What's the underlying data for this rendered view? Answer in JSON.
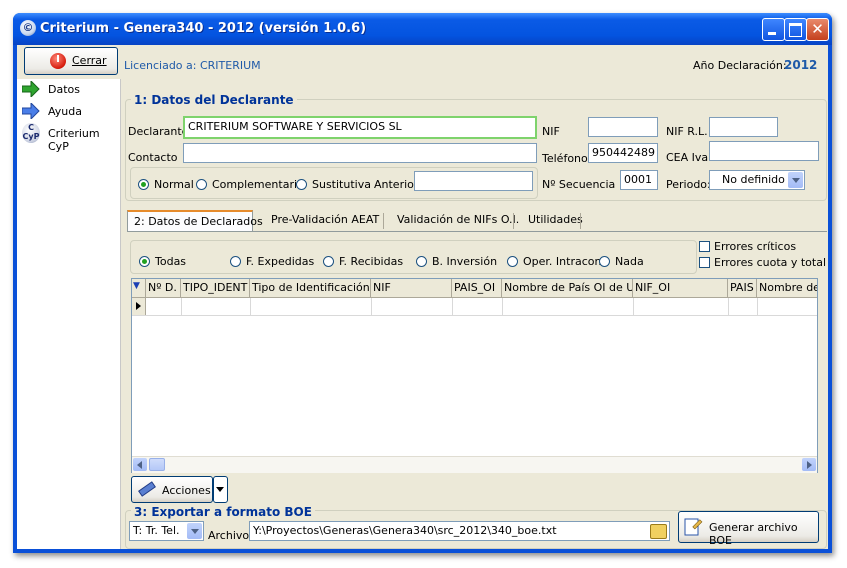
{
  "window": {
    "title": "Criterium - Genera340 - 2012 (versión 1.0.6)",
    "icon": "criterium-app-icon"
  },
  "toolbar": {
    "close_label": "Cerrar",
    "licensed_label": "Licenciado a: CRITERIUM",
    "year_label": "Año Declaración:",
    "year_value": "2012"
  },
  "sidebar": {
    "items": [
      {
        "label": "Datos",
        "icon": "green-arrow-icon"
      },
      {
        "label": "Ayuda",
        "icon": "blue-arrow-icon"
      },
      {
        "label": "Criterium CyP",
        "icon": "cyp-logo-icon"
      }
    ]
  },
  "declarante": {
    "section_title": "1: Datos del Declarante",
    "declarante_label": "Declarante",
    "declarante_value": "CRITERIUM SOFTWARE Y SERVICIOS SL",
    "contacto_label": "Contacto",
    "contacto_value": "",
    "nif_label": "NIF",
    "nif_value": "",
    "nifrl_label": "NIF R.L.",
    "nifrl_value": "",
    "telefono_label": "Teléfono",
    "telefono_value": "950442489",
    "ceaiva_label": "CEA Iva",
    "ceaiva_value": "",
    "tipo_options": [
      "Normal",
      "Complementaria",
      "Sustitutiva"
    ],
    "tipo_selected": "Normal",
    "anterior_label": "Anterior",
    "anterior_value": "",
    "secuencia_label": "Nº Secuencia",
    "secuencia_value": "0001",
    "periodo_label": "Periodo:",
    "periodo_value": "No definido"
  },
  "tabs": [
    {
      "label": "2: Datos de Declarados",
      "active": true
    },
    {
      "label": "Pre-Validación AEAT",
      "active": false
    },
    {
      "label": "Validación de NIFs O.I.",
      "active": false
    },
    {
      "label": "Utilidades",
      "active": false
    }
  ],
  "filters": {
    "options": [
      "Todas",
      "F. Expedidas",
      "F. Recibidas",
      "B. Inversión",
      "Oper. Intracom.",
      "Nada"
    ],
    "selected": "Todas",
    "checks": [
      {
        "label": "Errores críticos",
        "checked": false
      },
      {
        "label": "Errores cuota y total",
        "checked": false
      }
    ]
  },
  "grid": {
    "columns": [
      "Nº D.",
      "TIPO_IDENT",
      "Tipo de Identificación",
      "NIF",
      "PAIS_OI",
      "Nombre de País OI de UE",
      "NIF_OI",
      "PAIS",
      "Nombre de"
    ]
  },
  "actions": {
    "label": "Acciones"
  },
  "export": {
    "section_title": "3: Exportar a formato BOE",
    "type_value": "T: Tr. Tel.",
    "archivo_label": "Archivo",
    "archivo_value": "Y:\\Proyectos\\Generas\\Genera340\\src_2012\\340_boe.txt",
    "generate_label": "Generar archivo BOE"
  },
  "colors": {
    "titlebar": "#0454e0",
    "section_title": "#003399",
    "focus_border": "#7ed36c",
    "client_bg": "#ece9d8"
  }
}
